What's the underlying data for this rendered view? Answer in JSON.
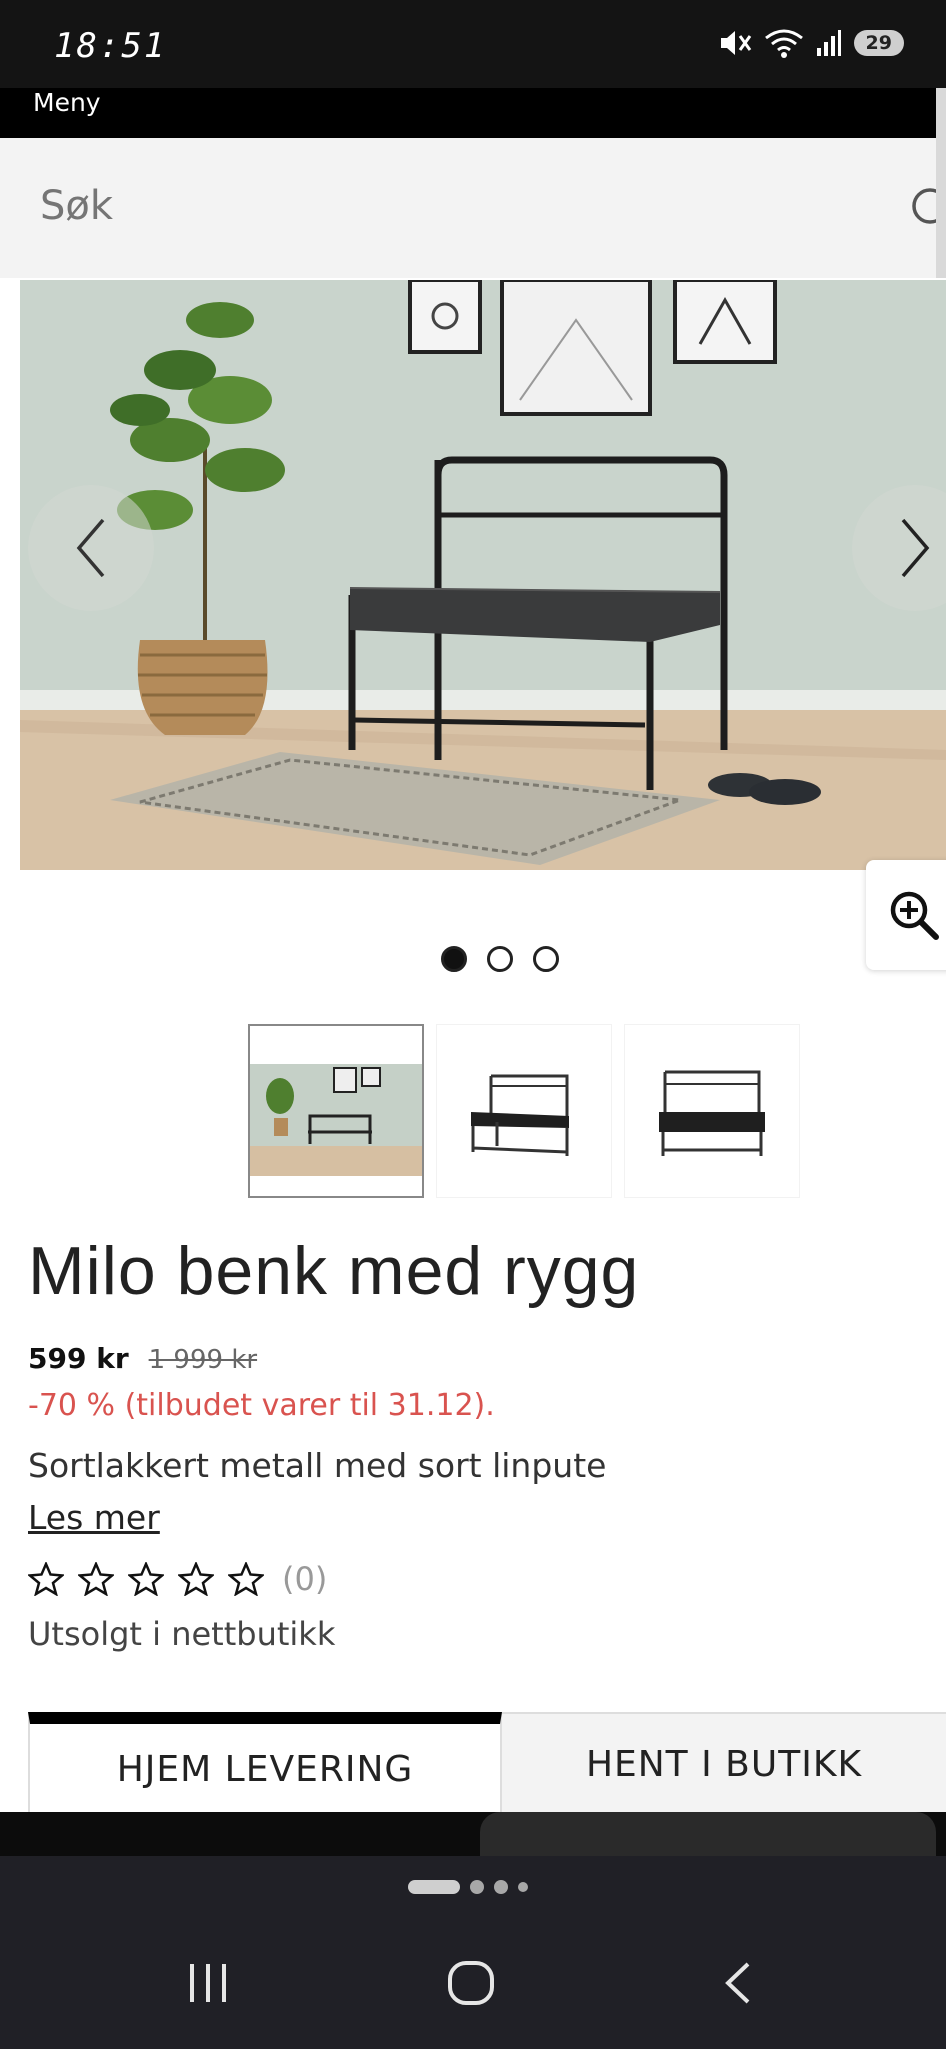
{
  "status_bar": {
    "time": "18:51",
    "battery": "29"
  },
  "menu": {
    "label": "Meny"
  },
  "search": {
    "placeholder": "Søk"
  },
  "gallery": {
    "slide_count": 3,
    "active_slide": 1
  },
  "product": {
    "title": "Milo benk med rygg",
    "price": "599 kr",
    "old_price": "1 999 kr",
    "discount": "-70 % (tilbudet varer til 31.12).",
    "description": "Sortlakkert metall med sort linpute",
    "read_more": "Les mer",
    "rating_count": "(0)",
    "stars": 0,
    "stock": "Utsolgt i nettbutikk"
  },
  "tabs": [
    {
      "label": "HJEM LEVERING",
      "active": true
    },
    {
      "label": "HENT I BUTIKK",
      "active": false
    }
  ],
  "icons": {
    "search": "search-icon",
    "prev": "chevron-left-icon",
    "next": "chevron-right-icon",
    "zoom": "zoom-in-icon",
    "star": "star-outline-icon"
  }
}
